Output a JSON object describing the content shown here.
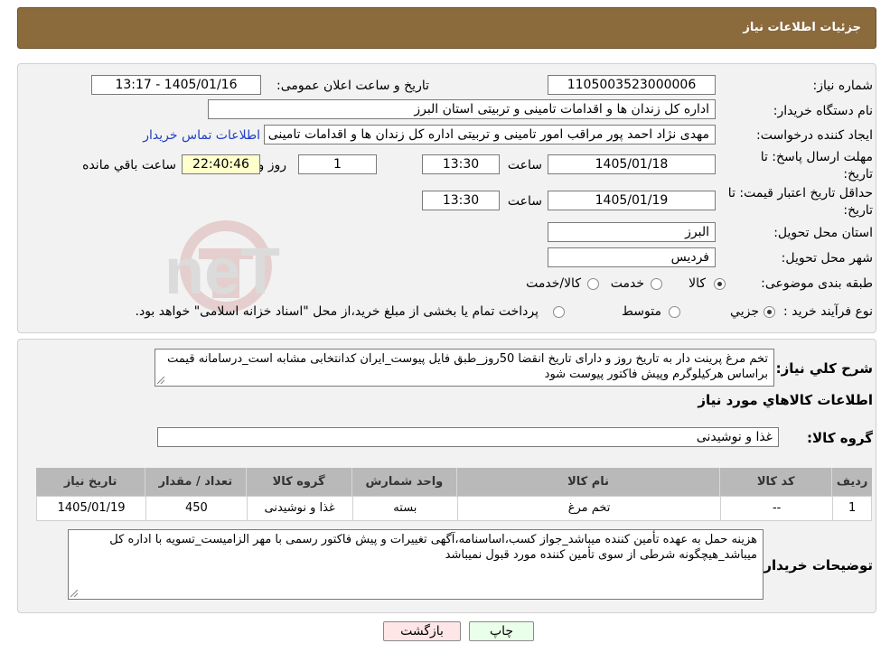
{
  "header": {
    "title": "جزئیات اطلاعات نیاز"
  },
  "need_number": {
    "label": "شماره نیاز:",
    "value": "1105003523000006"
  },
  "announce": {
    "label": "تاریخ و ساعت اعلان عمومی:",
    "value": "1405/01/16 - 13:17"
  },
  "buyer_org": {
    "label": "نام دستگاه خریدار:",
    "value": "اداره کل زندان ها و اقدامات تامینی و تربیتی استان البرز"
  },
  "requester": {
    "label": "ایجاد کننده درخواست:",
    "value": "مهدی نژاد احمد پور مراقب امور تامینی و تربیتی اداره کل زندان ها و اقدامات تامینی",
    "contact_link": "اطلاعات تماس خریدار"
  },
  "reply_deadline": {
    "label_line1": "مهلت ارسال پاسخ: تا",
    "label_line2": "تاریخ:",
    "date": "1405/01/18",
    "time_label": "ساعت",
    "time": "13:30",
    "days": "1",
    "days_label": "روز و",
    "remaining": "22:40:46",
    "remaining_label": "ساعت باقي مانده"
  },
  "price_validity": {
    "label_line1": "حداقل تاریخ اعتبار قیمت: تا",
    "label_line2": "تاریخ:",
    "date": "1405/01/19",
    "time_label": "ساعت",
    "time": "13:30"
  },
  "province": {
    "label": "استان محل تحویل:",
    "value": "البرز"
  },
  "city": {
    "label": "شهر محل تحویل:",
    "value": "فردیس"
  },
  "category": {
    "label": "طبقه بندی موضوعی:",
    "options": [
      "کالا",
      "خدمت",
      "کالا/خدمت"
    ],
    "selected": 0
  },
  "purchase_type": {
    "label": "نوع فرآیند خرید :",
    "options": [
      "جزیي",
      "متوسط"
    ],
    "selected": 0,
    "note": "پرداخت تمام یا بخشی از مبلغ خرید،از محل \"اسناد خزانه اسلامی\" خواهد بود."
  },
  "description": {
    "label": "شرح كلي نياز:",
    "value": "تخم مرغ پرینت دار به تاریخ روز و دارای تاریخ انقضا 50روز_طبق فایل پیوست_ایران کدانتخابی مشابه است_درسامانه قیمت براساس هرکیلوگرم وپیش فاکتور پیوست شود"
  },
  "goods_info": {
    "title": "اطلاعات كالاهاي مورد نياز"
  },
  "goods_group": {
    "label": "گروه کالا:",
    "value": "غذا و نوشیدنی"
  },
  "table": {
    "headers": [
      "ردیف",
      "کد کالا",
      "نام کالا",
      "واحد شمارش",
      "گروه کالا",
      "تعداد / مقدار",
      "تاریخ نیاز"
    ],
    "rows": [
      [
        "1",
        "--",
        "تخم مرغ",
        "بسته",
        "غذا و نوشیدنی",
        "450",
        "1405/01/19"
      ]
    ]
  },
  "buyer_notes": {
    "label": "توضیحات خریدار:",
    "value": "هزینه حمل به عهده تأمین کننده میباشد_جواز کسب،اساسنامه،آگهی تغییرات و پیش فاکتور رسمی با مهر الزامیست_تسویه با اداره کل میباشد_هیچگونه شرطی از سوی تأمین کننده مورد قبول نمیباشد"
  },
  "buttons": {
    "print": "چاپ",
    "back": "بازگشت"
  },
  "colors": {
    "header": "#8b6a3c",
    "link": "#1f3ec4",
    "back_button": "#ffe6e6",
    "print_button": "#eaffea"
  }
}
